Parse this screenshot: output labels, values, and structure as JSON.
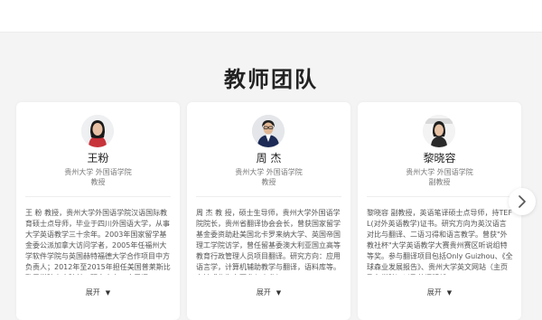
{
  "section": {
    "title": "教师团队"
  },
  "teachers": [
    {
      "name": "王粉",
      "dept": "贵州大学 外国语学院",
      "title": "教授",
      "bio": "王 粉 教授，贵州大学外国语学院汉语国际教育硕士点导师，毕业于四川外国语大学，从事大学英语教学三十余年。2003年国家留学基金委公派加拿大访问学者，2005年任福州大学软件学院与英国赫特福德大学合作项目中方负责人；2012年至2015年担任美国普莱斯比孔子学院中方院长。研究方向：应用语",
      "expand": "展开"
    },
    {
      "name": "周 杰",
      "dept": "贵州大学 外国语学院",
      "title": "教授",
      "bio": "周 杰 教 授，硕士生导师，贵州大学外国语学院院长，贵州省翻译协会会长，曾获国家留学基金委资助赴美国北卡罗来纳大学、英国帝国理工学院访学，曾任留基委澳大利亚国立高等教育行政管理人员项目翻译。研究方向：应用语言学，计算机辅助教学与翻译，语料库等。主持或作为主要参与人参加",
      "expand": "展开"
    },
    {
      "name": "黎晓容",
      "dept": "贵州大学 外国语学院",
      "title": "副教授",
      "bio": "黎晓容 副教授，英语笔译硕士点导师，持TEFL(对外英语教学)证书。研究方向为英汉语言对比与翻译、二语习得和语言教学。曾获\"外教社杯\"大学英语教学大赛贵州赛区听说组特等奖。参与翻译项目包括Only Guizhou、《全球森业发展报告》、贵州大学英文网站（主页及各学院）以及英语版新",
      "expand": "展开"
    }
  ],
  "icons": {
    "expand": "caret-down-icon",
    "next": "chevron-right-icon"
  },
  "colors": {
    "background": "#f4f4f4",
    "card": "#ffffff",
    "title": "#222222"
  }
}
